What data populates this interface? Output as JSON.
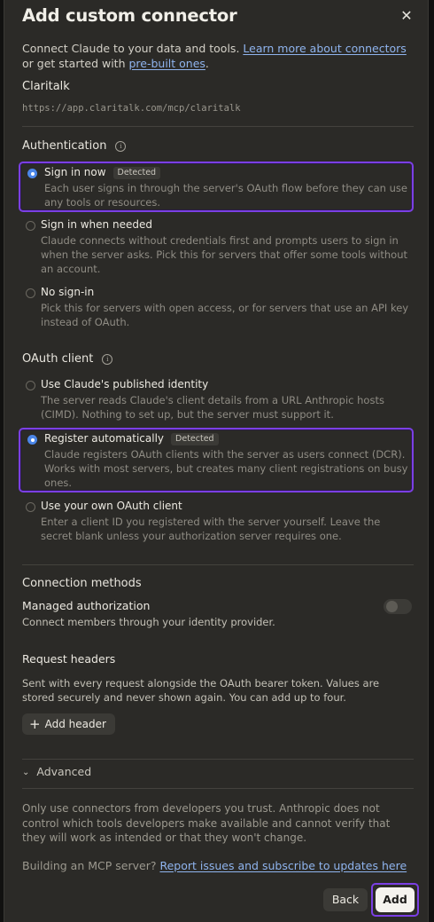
{
  "dialog": {
    "title": "Add custom connector",
    "close_icon": "close-icon"
  },
  "intro": {
    "text_before": "Connect Claude to your data and tools. ",
    "link1": "Learn more about connectors",
    "text_middle": " or get started with ",
    "link2": "pre-built ones",
    "text_after": "."
  },
  "connector": {
    "name": "Claritalk",
    "url": "https://app.claritalk.com/mcp/claritalk"
  },
  "authentication": {
    "title": "Authentication",
    "info_icon": "i",
    "options": [
      {
        "label": "Sign in now",
        "badge": "Detected",
        "selected": true,
        "description": "Each user signs in through the server's OAuth flow before they can use any tools or resources."
      },
      {
        "label": "Sign in when needed",
        "badge": "",
        "selected": false,
        "description": "Claude connects without credentials first and prompts users to sign in when the server asks. Pick this for servers that offer some tools without an account."
      },
      {
        "label": "No sign-in",
        "badge": "",
        "selected": false,
        "description": "Pick this for servers with open access, or for servers that use an API key instead of OAuth."
      }
    ]
  },
  "oauth_client": {
    "title": "OAuth client",
    "info_icon": "i",
    "options": [
      {
        "label": "Use Claude's published identity",
        "badge": "",
        "selected": false,
        "description": "The server reads Claude's client details from a URL Anthropic hosts (CIMD). Nothing to set up, but the server must support it."
      },
      {
        "label": "Register automatically",
        "badge": "Detected",
        "selected": true,
        "description": "Claude registers OAuth clients with the server as users connect (DCR). Works with most servers, but creates many client registrations on busy ones."
      },
      {
        "label": "Use your own OAuth client",
        "badge": "",
        "selected": false,
        "description": "Enter a client ID you registered with the server yourself. Leave the secret blank unless your authorization server requires one."
      }
    ]
  },
  "connection_methods": {
    "title": "Connection methods",
    "managed_label": "Managed authorization",
    "managed_desc": "Connect members through your identity provider.",
    "managed_enabled": false
  },
  "request_headers": {
    "title": "Request headers",
    "description": "Sent with every request alongside the OAuth bearer token. Values are stored securely and never shown again. You can add up to four.",
    "add_plus": "+",
    "add_label": "Add header"
  },
  "advanced": {
    "chevron": "⌄",
    "label": "Advanced"
  },
  "footer": {
    "trust_text": "Only use connectors from developers you trust. Anthropic does not control which tools developers make available and cannot verify that they will work as intended or that they won't change.",
    "build_prefix": "Building an MCP server? ",
    "build_link": "Report issues and subscribe to updates here",
    "back_label": "Back",
    "add_label": "Add"
  },
  "colors": {
    "accent_outline": "#7b3fe4",
    "radio_selected": "#4b86e8",
    "link": "#8fb4ee",
    "dialog_bg": "#2b2a27"
  }
}
